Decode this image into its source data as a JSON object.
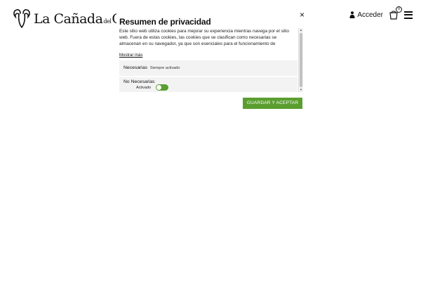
{
  "header": {
    "logo": {
      "text_main": "La Cañada",
      "text_small": "del",
      "text_end": "Cap",
      "icon": "ram-head-icon"
    },
    "login_label": "Acceder",
    "login_icon": "person-icon",
    "cart_icon": "shopping-bag-icon",
    "cart_count": "0",
    "menu_icon": "hamburger-menu-icon"
  },
  "privacy_modal": {
    "title": "Resumen de privacidad",
    "description": "Este sitio web utiliza cookies para mejorar su experiencia mientras navega por el sitio web. Fuera de estas cookies, las cookies que se clasifican como necesarias se almacenan en su navegador, ya que son esenciales para el funcionamiento de",
    "show_more": "Mostrar más",
    "close_symbol": "×",
    "categories": [
      {
        "label": "Necesarias",
        "status": "Siempre activado"
      },
      {
        "label": "No Necesarias",
        "toggle_label": "Activado",
        "toggle_on": true
      }
    ],
    "save_button": "GUARDAR Y ACEPTAR"
  },
  "colors": {
    "accent_green": "#5a9e2f",
    "panel_gray": "#f3f3f3",
    "text_dark": "#111111"
  }
}
